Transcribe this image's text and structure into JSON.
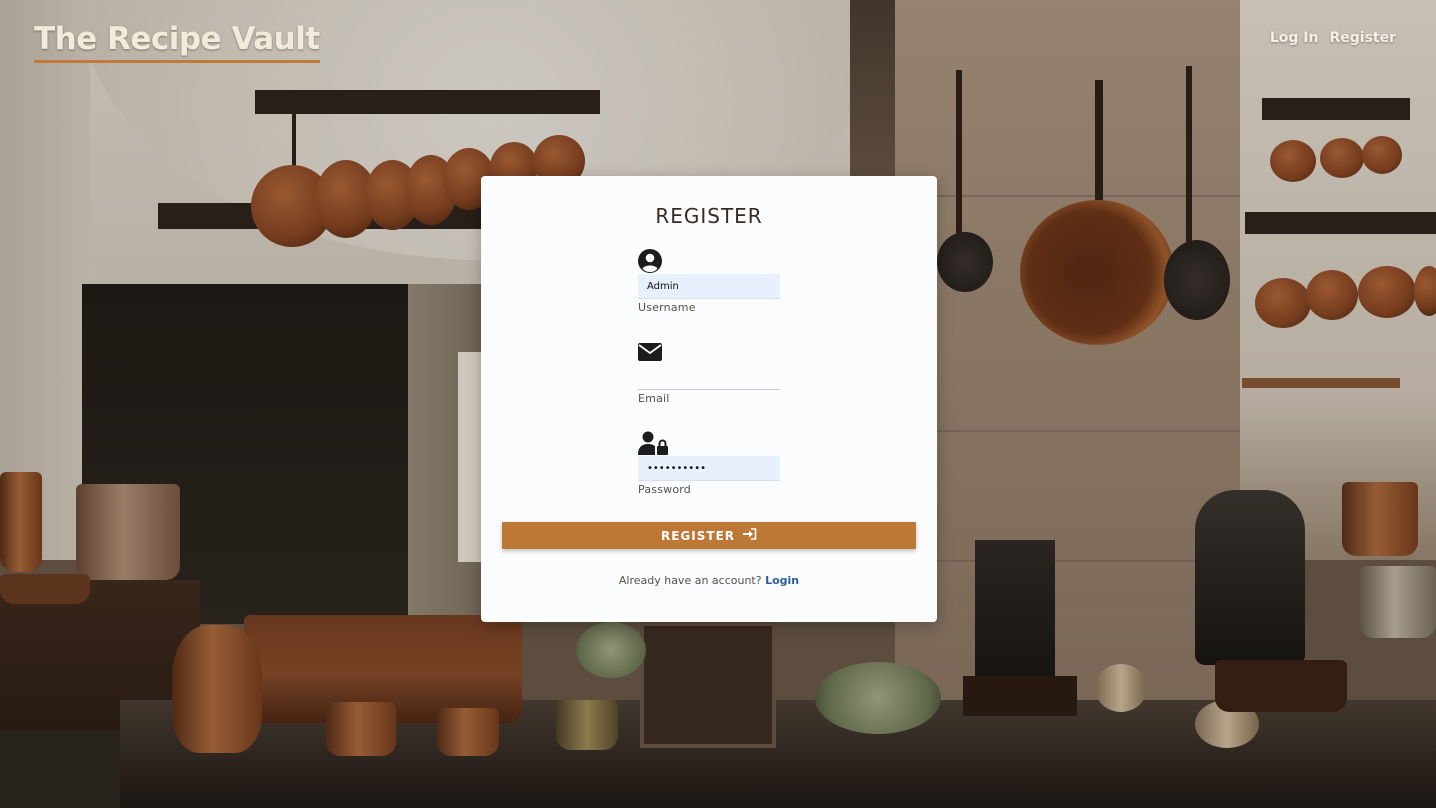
{
  "header": {
    "brand": "The Recipe Vault",
    "nav": {
      "login": "Log In",
      "register": "Register"
    }
  },
  "form": {
    "title": "REGISTER",
    "username": {
      "icon": "user-circle-icon",
      "value": "Admin",
      "label": "Username"
    },
    "email": {
      "icon": "envelope-icon",
      "value": "",
      "label": "Email"
    },
    "password": {
      "icon": "user-lock-icon",
      "value": "••••••••••",
      "label": "Password"
    },
    "submit": {
      "label": "REGISTER",
      "icon": "sign-in-icon"
    },
    "footer": {
      "prompt": "Already have an account?",
      "link": "Login"
    }
  },
  "colors": {
    "accent": "#bd7836",
    "link": "#2f5e9e",
    "card_bg": "#fbfcfe",
    "autofill_bg": "#e8f0fe"
  }
}
